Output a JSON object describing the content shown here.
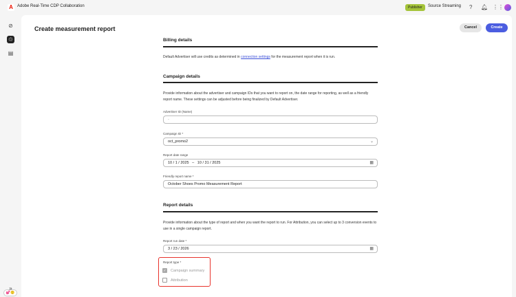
{
  "app": {
    "title": "Adobe Real-Time CDP Collaboration",
    "role_badge": "Publisher",
    "org": "Source Streaming",
    "logo": "A"
  },
  "header_icons": [
    "help-icon",
    "bell-icon",
    "apps-grid-icon",
    "avatar"
  ],
  "sidebar": {
    "items": [
      "discover-icon",
      "collaborate-icon",
      "reports-icon"
    ],
    "expand": "»",
    "feedback": "💕🙂"
  },
  "page": {
    "title": "Create measurement report",
    "cancel": "Cancel",
    "create": "Create"
  },
  "billing": {
    "heading": "Billing details",
    "text_before": "Default Advertiser will use credits as determined in ",
    "link": "connection settings",
    "text_after": " for the measurement report when it is run."
  },
  "campaign": {
    "heading": "Campaign details",
    "desc": "Provide information about the advertiser and campaign IDs that you want to report on, the date range for reporting, as well as a friendly report name. These settings can be adjusted before being finalized by Default Advertiser.",
    "advertiser_label": "Advertiser ID (Name)",
    "advertiser_value": "-",
    "campaign_label": "Campaign ID *",
    "campaign_value": "oct_promo2",
    "range_label": "Report date range",
    "range_value": "10 / 1 / 2025   –   10 / 31 / 2025",
    "name_label": "Friendly report name *",
    "name_value": "October Shoes Promo Measurement Report"
  },
  "report": {
    "heading": "Report details",
    "desc": "Provide information about the type of report and when you want the report to run. For Attribution, you can select up to 3 conversion events to use in a single campaign report.",
    "run_label": "Report run date *",
    "run_value": "3 / 23 / 2026",
    "type_label": "Report type *",
    "options": [
      {
        "label": "Campaign summary",
        "checked": true
      },
      {
        "label": "Attribution",
        "checked": false
      }
    ]
  }
}
